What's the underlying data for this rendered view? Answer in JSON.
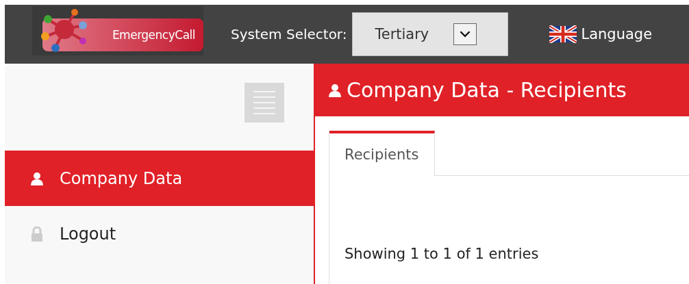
{
  "header": {
    "logo_text": "EmergencyCall",
    "system_selector": {
      "label": "System Selector:",
      "value": "Tertiary"
    },
    "language": "Language"
  },
  "sidebar": {
    "items": [
      {
        "label": "Company Data",
        "kind": "user",
        "selected": true
      },
      {
        "label": "Logout",
        "kind": "lock",
        "selected": false
      }
    ]
  },
  "page": {
    "title": "Company Data - Recipients",
    "tabs": [
      {
        "label": "Recipients",
        "selected": true
      }
    ],
    "info": "Showing 1 to 1 of 1 entries"
  }
}
